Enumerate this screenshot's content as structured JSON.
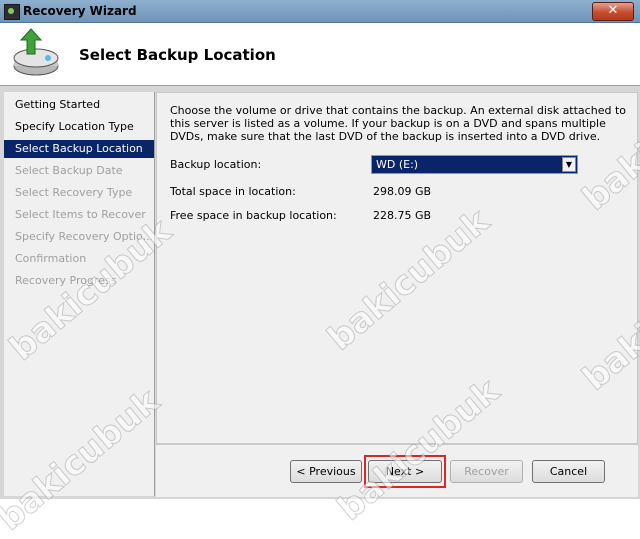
{
  "window": {
    "title": "Recovery Wizard",
    "close_glyph": "✕"
  },
  "header": {
    "title": "Select Backup Location",
    "icon": "backup-restore-icon"
  },
  "steps": [
    {
      "label": "Getting Started",
      "state": "done"
    },
    {
      "label": "Specify Location Type",
      "state": "done"
    },
    {
      "label": "Select Backup Location",
      "state": "active"
    },
    {
      "label": "Select Backup Date",
      "state": "pending"
    },
    {
      "label": "Select Recovery Type",
      "state": "pending"
    },
    {
      "label": "Select Items to Recover",
      "state": "pending"
    },
    {
      "label": "Specify Recovery Optio...",
      "state": "pending"
    },
    {
      "label": "Confirmation",
      "state": "pending"
    },
    {
      "label": "Recovery Progress",
      "state": "pending"
    }
  ],
  "main": {
    "description": "Choose the volume or drive that contains the backup. An external disk attached to this server is listed as a volume. If your backup is on a DVD and spans multiple DVDs, make sure that the last DVD of the backup is inserted into a DVD drive.",
    "backup_location_label": "Backup location:",
    "backup_location_value": "WD (E:)",
    "total_space_label": "Total space in location:",
    "total_space_value": "298.09 GB",
    "free_space_label": "Free space in backup location:",
    "free_space_value": "228.75 GB"
  },
  "buttons": {
    "previous": "< Previous",
    "next": "Next >",
    "recover": "Recover",
    "cancel": "Cancel"
  },
  "watermark": "bakicubuk",
  "colors": {
    "selection": "#0a246a",
    "highlight_box": "#d72727"
  }
}
